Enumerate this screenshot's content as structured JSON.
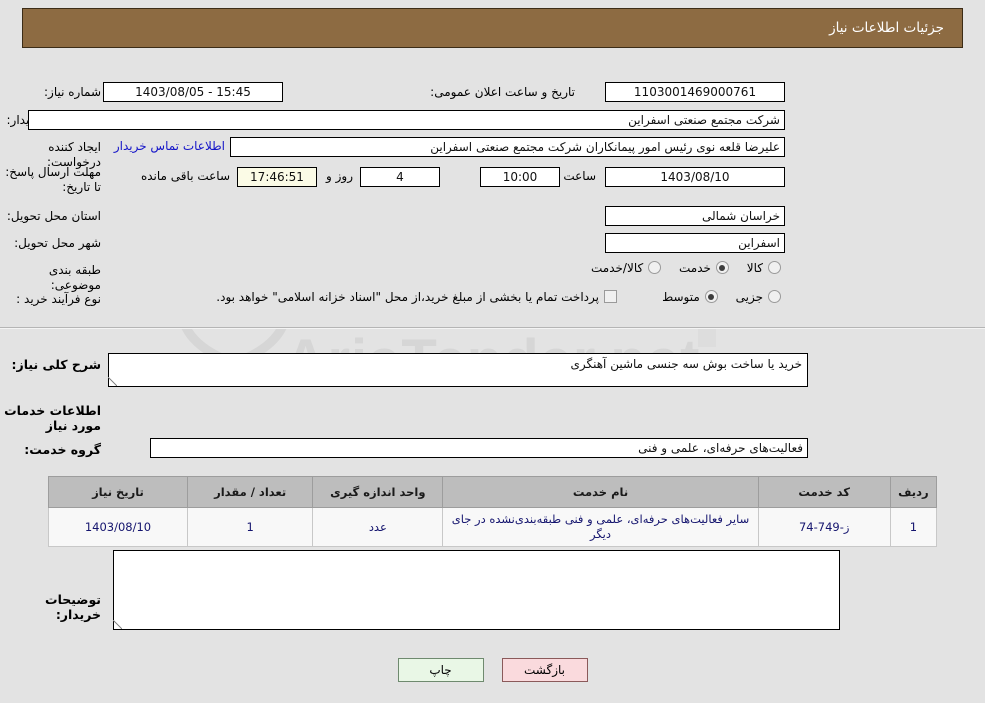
{
  "header": {
    "title": "جزئیات اطلاعات نیاز"
  },
  "watermark": {
    "text": "AriaTender.net"
  },
  "form": {
    "need_number_label": "شماره نیاز:",
    "need_number_value": "1103001469000761",
    "announce_label": "تاریخ و ساعت اعلان عمومی:",
    "announce_value": "1403/08/05 - 15:45",
    "buyer_org_label": "نام دستگاه خریدار:",
    "buyer_org_value": "شرکت مجتمع صنعتی اسفراین",
    "creator_label": "ایجاد کننده درخواست:",
    "creator_value": "علیرضا قلعه نوی رئیس امور پیمانکاران شرکت مجتمع صنعتی اسفراین",
    "contact_link": "اطلاعات تماس خریدار",
    "deadline_label": "مهلت ارسال پاسخ: تا تاریخ:",
    "deadline_date": "1403/08/10",
    "deadline_hour_label": "ساعت",
    "deadline_time": "10:00",
    "remaining_days": "4",
    "remaining_days_label": "روز و",
    "remaining_clock": "17:46:51",
    "remaining_suffix": "ساعت باقی مانده",
    "province_label": "استان محل تحویل:",
    "province_value": "خراسان شمالی",
    "city_label": "شهر محل تحویل:",
    "city_value": "اسفراین",
    "category_label": "طبقه بندی موضوعی:",
    "category_options": [
      {
        "label": "کالا",
        "selected": false
      },
      {
        "label": "خدمت",
        "selected": true
      },
      {
        "label": "کالا/خدمت",
        "selected": false
      }
    ],
    "process_label": "نوع فرآیند خرید :",
    "process_options": [
      {
        "label": "جزیی",
        "selected": false
      },
      {
        "label": "متوسط",
        "selected": true
      }
    ],
    "treasury_checkbox_label": "پرداخت تمام یا بخشی از مبلغ خرید،از محل \"اسناد خزانه اسلامی\" خواهد بود.",
    "treasury_checked": false
  },
  "description": {
    "label": "شرح کلی نیاز:",
    "value": "خرید یا ساخت بوش سه جنسی ماشین آهنگری"
  },
  "services": {
    "section_title": "اطلاعات خدمات مورد نیاز",
    "group_label": "گروه خدمت:",
    "group_value": "فعالیت‌های حرفه‌ای، علمی و فنی",
    "columns": [
      "ردیف",
      "کد خدمت",
      "نام خدمت",
      "واحد اندازه گیری",
      "تعداد / مقدار",
      "تاریخ نیاز"
    ],
    "rows": [
      {
        "radif": "1",
        "code": "ز-749-74",
        "name": "سایر فعالیت‌های حرفه‌ای، علمی و فنی طبقه‌بندی‌نشده در جای دیگر",
        "unit": "عدد",
        "qty": "1",
        "date": "1403/08/10"
      }
    ]
  },
  "buyer_notes": {
    "label": "توضیحات خریدار:",
    "value": ""
  },
  "buttons": {
    "back": "بازگشت",
    "print": "چاپ"
  },
  "colors": {
    "header_bg": "#8d6b42",
    "link": "#1414c8",
    "back_btn": "#fadadd",
    "print_btn": "#e9f7e6"
  }
}
